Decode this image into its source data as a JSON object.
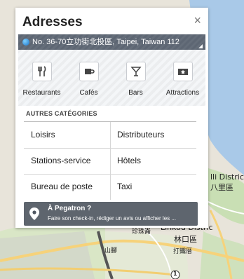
{
  "panel": {
    "title": "Adresses",
    "close_symbol": "×",
    "address": "No. 36-70立功街北投區, Taipei, Taiwan 112",
    "categories": [
      {
        "label": "Restaurants",
        "icon": "fork-knife-icon"
      },
      {
        "label": "Cafés",
        "icon": "coffee-cup-icon"
      },
      {
        "label": "Bars",
        "icon": "cocktail-glass-icon"
      },
      {
        "label": "Attractions",
        "icon": "ticket-star-icon"
      }
    ],
    "other_heading": "AUTRES CATÉGORIES",
    "other_categories": [
      "Loisirs",
      "Distributeurs",
      "Stations-service",
      "Hôtels",
      "Bureau de poste",
      "Taxi"
    ]
  },
  "toast": {
    "title": "À Pegatron ?",
    "text": "Faire son check-in, rédiger un avis ou afficher les ..."
  },
  "map": {
    "labels": [
      "lli District",
      "八里區",
      "珍珠崙",
      "Linkou Distric",
      "林口區",
      "山腳",
      "打鐵厝",
      "1"
    ]
  }
}
